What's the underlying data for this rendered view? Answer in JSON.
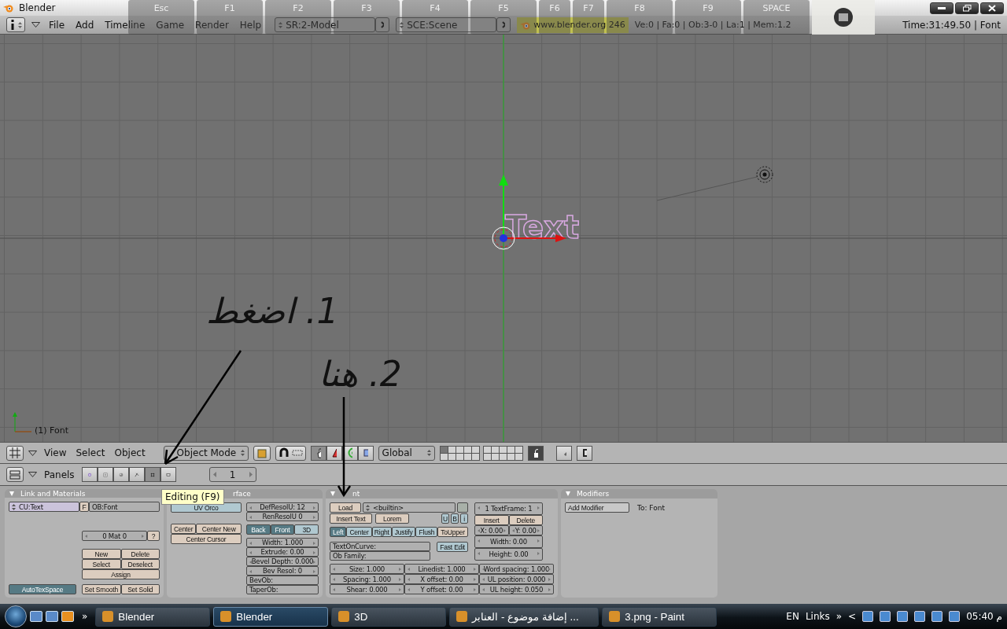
{
  "window": {
    "title": "Blender"
  },
  "info_header": {
    "menus": [
      "File",
      "Add",
      "Timeline",
      "Game",
      "Render",
      "Help"
    ],
    "screen": "SR:2-Model",
    "scene": "SCE:Scene",
    "url": "www.blender.org 246",
    "stats": "Ve:0 | Fa:0 | Ob:3-0 | La:1 | Mem:1.2",
    "time": "Time:31:49.50 | Font"
  },
  "key_overlay": [
    "Esc",
    "F1",
    "F2",
    "F3",
    "F4",
    "F5",
    "F6",
    "F7",
    "F8",
    "F9",
    "SPACE"
  ],
  "viewport": {
    "object_text": "Text",
    "frame_label": "(1) Font"
  },
  "annotations": [
    "1. اضغط",
    "2. هنا"
  ],
  "view_header": {
    "menus": [
      "View",
      "Select",
      "Object"
    ],
    "mode": "Object Mode",
    "orientation": "Global"
  },
  "buttons_header": {
    "label": "Panels",
    "contexts": [
      {
        "selected": false
      },
      {
        "selected": false
      },
      {
        "selected": false
      },
      {
        "selected": false
      },
      {
        "selected": true
      },
      {
        "selected": false
      }
    ],
    "frame": "1"
  },
  "tooltip": "Editing (F9)",
  "panels": [
    {
      "title": "Link and Materials",
      "widgets": [
        {
          "kind": "menu",
          "label": "CU:Text"
        },
        {
          "kind": "button",
          "label": "F"
        },
        {
          "kind": "field",
          "label": "OB:Font"
        },
        {
          "kind": "num",
          "label": "0 Mat 0"
        },
        {
          "kind": "button",
          "label": "?"
        },
        {
          "kind": "button",
          "label": "New"
        },
        {
          "kind": "button",
          "label": "Delete"
        },
        {
          "kind": "button",
          "label": "Select"
        },
        {
          "kind": "button",
          "label": "Deselect"
        },
        {
          "kind": "button",
          "label": "Assign"
        },
        {
          "kind": "toggle",
          "label": "AutoTexSpace",
          "selected": true
        },
        {
          "kind": "button",
          "label": "Set Smooth"
        },
        {
          "kind": "button",
          "label": "Set Solid"
        }
      ]
    },
    {
      "title": "rface",
      "widgets": [
        {
          "kind": "toggle",
          "label": "UV Orco",
          "selected": false
        },
        {
          "kind": "button",
          "label": "Center"
        },
        {
          "kind": "button",
          "label": "Center New"
        },
        {
          "kind": "button",
          "label": "Center Cursor"
        },
        {
          "kind": "num",
          "label": "DefResolU: 12"
        },
        {
          "kind": "num",
          "label": "RenResolU 0"
        },
        {
          "kind": "toggle",
          "label": "Back",
          "selected": true
        },
        {
          "kind": "toggle",
          "label": "Front",
          "selected": true
        },
        {
          "kind": "toggle",
          "label": "3D",
          "selected": false
        },
        {
          "kind": "num",
          "label": "Width: 1.000"
        },
        {
          "kind": "num",
          "label": "Extrude: 0.00"
        },
        {
          "kind": "num",
          "label": "Bevel Depth: 0.000"
        },
        {
          "kind": "num",
          "label": "Bev Resol: 0"
        },
        {
          "kind": "field",
          "label": "BevOb:"
        },
        {
          "kind": "field",
          "label": "TaperOb:"
        }
      ]
    },
    {
      "title": "nt",
      "widgets": [
        {
          "kind": "button",
          "label": "Load"
        },
        {
          "kind": "menu",
          "label": "<builtin>"
        },
        {
          "kind": "pin"
        },
        {
          "kind": "button",
          "label": "Insert Text"
        },
        {
          "kind": "button",
          "label": "Lorem"
        },
        {
          "kind": "toggle",
          "label": "U",
          "selected": false
        },
        {
          "kind": "toggle",
          "label": "B",
          "selected": false
        },
        {
          "kind": "toggle",
          "label": "i",
          "selected": false
        },
        {
          "kind": "toggle",
          "label": "Left",
          "selected": true
        },
        {
          "kind": "toggle",
          "label": "Center",
          "selected": false
        },
        {
          "kind": "toggle",
          "label": "Right",
          "selected": false
        },
        {
          "kind": "toggle",
          "label": "Justify",
          "selected": false
        },
        {
          "kind": "toggle",
          "label": "Flush",
          "selected": false
        },
        {
          "kind": "button",
          "label": "ToUpper"
        },
        {
          "kind": "field",
          "label": "TextOnCurve:"
        },
        {
          "kind": "field",
          "label": "Ob Family:"
        },
        {
          "kind": "toggle",
          "label": "Fast Edit",
          "selected": false
        },
        {
          "kind": "num",
          "label": "1 TextFrame: 1"
        },
        {
          "kind": "button",
          "label": "Insert"
        },
        {
          "kind": "button",
          "label": "Delete"
        },
        {
          "kind": "num",
          "label": "X: 0.00"
        },
        {
          "kind": "num",
          "label": "Y: 0.00"
        },
        {
          "kind": "num",
          "label": "Width: 0.00"
        },
        {
          "kind": "num",
          "label": "Height: 0.00"
        },
        {
          "kind": "num",
          "label": "Size: 1.000"
        },
        {
          "kind": "num",
          "label": "Linedist: 1.000"
        },
        {
          "kind": "num",
          "label": "Word spacing: 1.000"
        },
        {
          "kind": "num",
          "label": "Spacing: 1.000"
        },
        {
          "kind": "num",
          "label": "X offset: 0.00"
        },
        {
          "kind": "num",
          "label": "UL position: 0.000"
        },
        {
          "kind": "num",
          "label": "Shear: 0.000"
        },
        {
          "kind": "num",
          "label": "Y offset: 0.00"
        },
        {
          "kind": "num",
          "label": "UL height: 0.050"
        }
      ]
    },
    {
      "title": "Modifiers",
      "widgets": [
        {
          "kind": "plain",
          "label": "Add Modifier"
        },
        {
          "kind": "label",
          "label": "To: Font"
        }
      ]
    }
  ],
  "taskbar": {
    "chevron": "»",
    "items": [
      {
        "label": "Blender",
        "selected": false
      },
      {
        "label": "Blender",
        "selected": true
      },
      {
        "label": "3D",
        "selected": false
      },
      {
        "label": "إضافة موضوع - العنابر ...",
        "selected": false
      },
      {
        "label": "3.png - Paint",
        "selected": false
      }
    ],
    "language": "EN",
    "links": "Links",
    "links_chevron": "»",
    "tray_arrow": "<",
    "clock": "05:40 م"
  }
}
